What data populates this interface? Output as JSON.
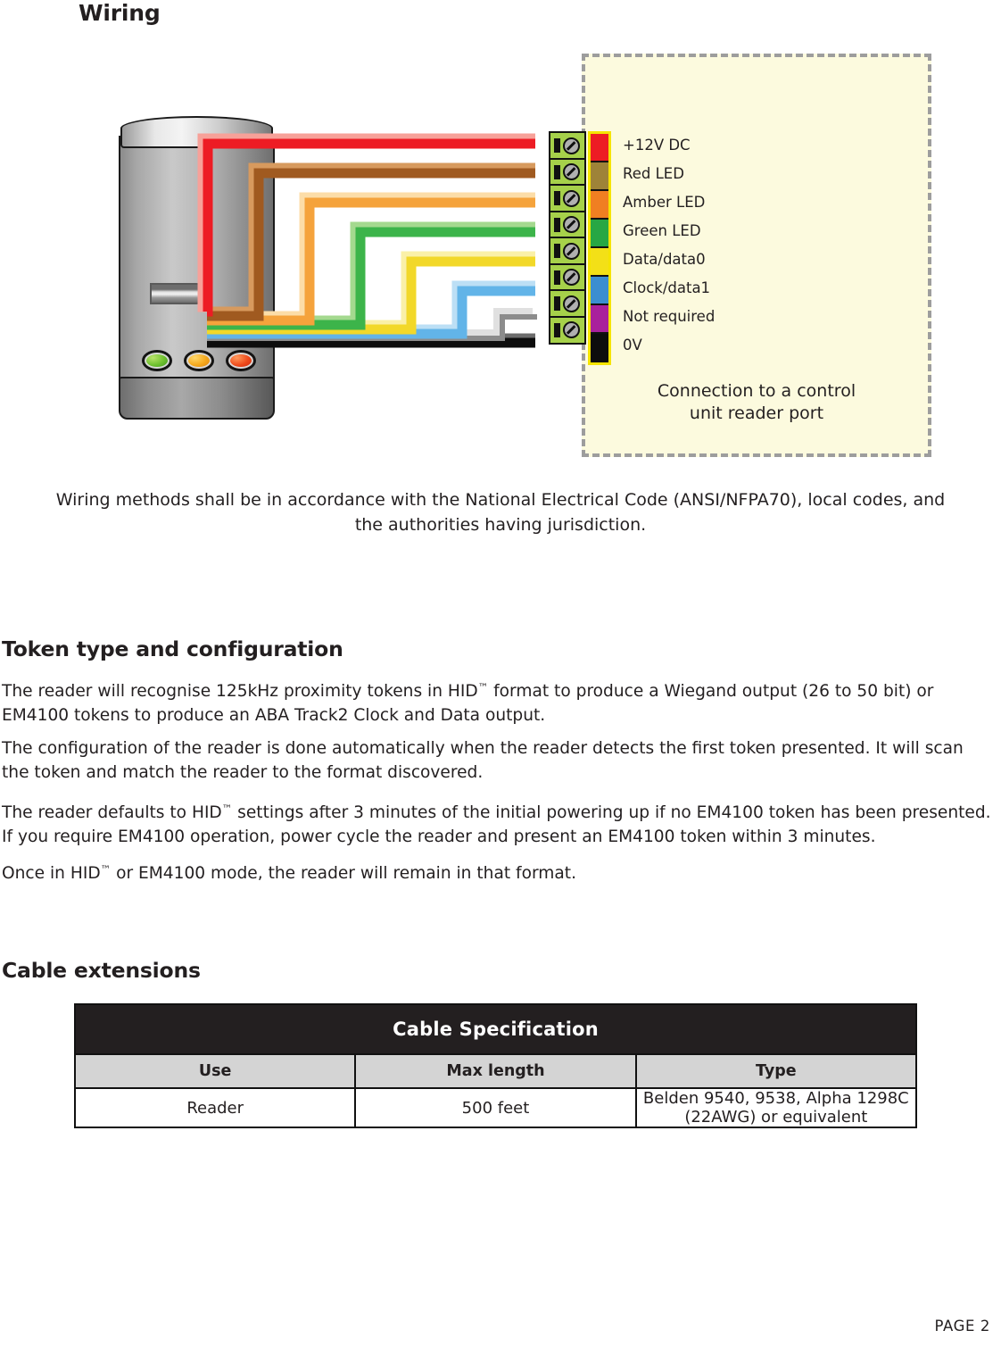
{
  "page": {
    "heading_wiring": "Wiring",
    "footer": "PAGE  2"
  },
  "diagram": {
    "connection_caption_line1": "Connection to a control",
    "connection_caption_line2": "unit reader port",
    "leds": [
      {
        "name": "green-led",
        "color": "#6ec12f"
      },
      {
        "name": "amber-led",
        "color": "#f5a81c"
      },
      {
        "name": "red-led",
        "color": "#ef4b1c"
      }
    ],
    "terminals": [
      {
        "label": "+12V DC",
        "color": "#ed1c24",
        "wire": "#ed1c24",
        "highlight": "#f7a199"
      },
      {
        "label": "Red LED",
        "color": "#9e8338",
        "wire": "#a05a20",
        "highlight": "#d79a5e"
      },
      {
        "label": "Amber LED",
        "color": "#f07f22",
        "wire": "#f5a33c",
        "highlight": "#fcdda8"
      },
      {
        "label": "Green LED",
        "color": "#27a744",
        "wire": "#3cb44a",
        "highlight": "#a4d98f"
      },
      {
        "label": "Data/data0",
        "color": "#f3e017",
        "wire": "#f2d829",
        "highlight": "#faf0a8"
      },
      {
        "label": "Clock/data1",
        "color": "#3b8ed0",
        "wire": "#62b4e8",
        "highlight": "#bcdff5"
      },
      {
        "label": "Not required",
        "color": "#a9219c",
        "wire": "#8c8c8c",
        "highlight": "#e0e0e0"
      },
      {
        "label": "0V",
        "color": "#0d0d0d",
        "wire": "#0d0d0d",
        "highlight": "#6d6d6d"
      }
    ]
  },
  "wiring_note": "Wiring methods shall be in accordance with the National Electrical Code (ANSI/NFPA70), local codes, and the authorities having jurisdiction.",
  "token_section": {
    "heading": "Token type and configuration",
    "paragraph_1_a": "The reader will recognise 125kHz proximity tokens in HID",
    "paragraph_1_b": " format to produce a Wiegand output (26 to 50 bit) or EM4100 tokens to produce an ABA Track2 Clock and Data output.",
    "paragraph_2": "The configuration of the reader is done automatically when the reader detects the first token presented. It will scan the token and match the reader to the format discovered.",
    "paragraph_3_a": "The reader defaults to HID",
    "paragraph_3_b": " settings after 3 minutes of the initial powering up if no EM4100 token has been presented. If you require EM4100 operation, power cycle the reader and present an EM4100 token within 3 minutes.",
    "paragraph_4_a": "Once in HID",
    "paragraph_4_b": " or EM4100 mode, the reader will remain in that format.",
    "trademark": "™"
  },
  "cable_section": {
    "heading": "Cable extensions",
    "table": {
      "title": "Cable Specification",
      "columns": [
        "Use",
        "Max length",
        "Type"
      ],
      "rows": [
        [
          "Reader",
          "500 feet",
          "Belden 9540, 9538, Alpha 1298C (22AWG) or equivalent"
        ]
      ]
    }
  }
}
